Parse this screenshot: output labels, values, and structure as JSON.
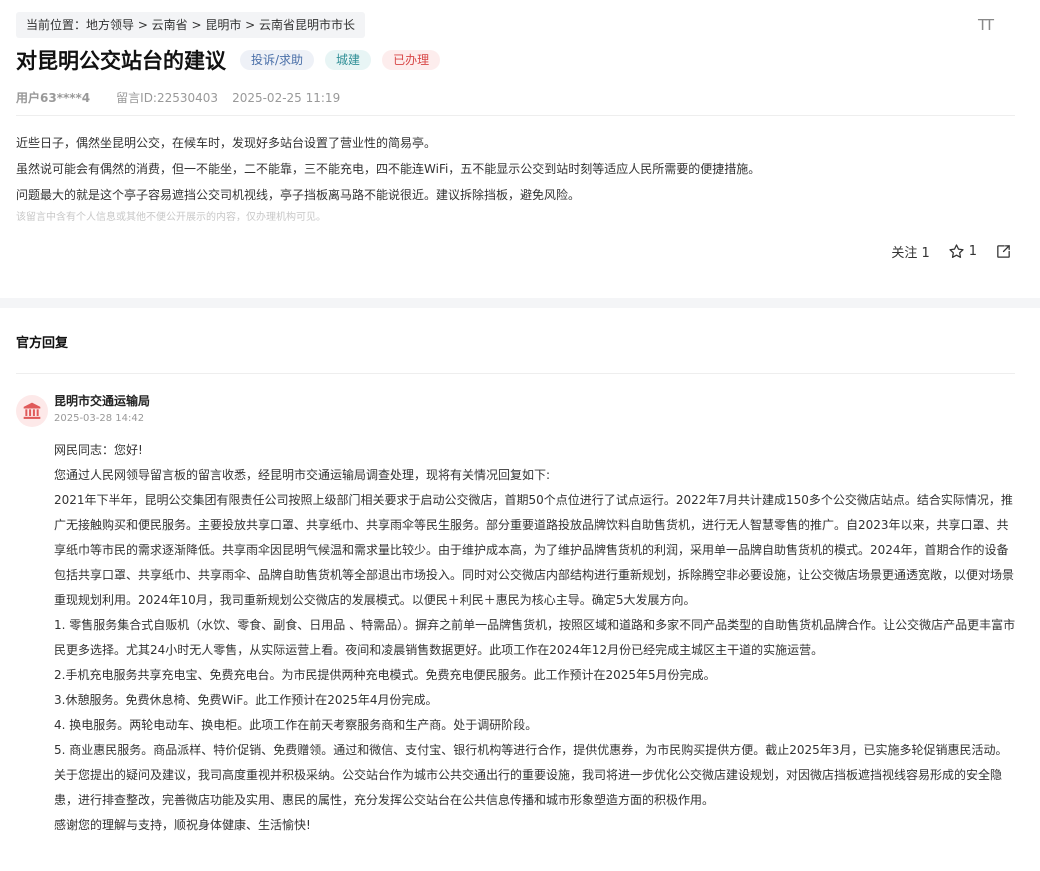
{
  "breadcrumb": "当前位置：地方领导 > 云南省 > 昆明市 > 云南省昆明市市长",
  "font_toggle": "TT",
  "title": "对昆明公交站台的建议",
  "tags": [
    "投诉/求助",
    "城建",
    "已办理"
  ],
  "meta": {
    "user": "用户63****4",
    "message_id": "留言ID:22530403",
    "datetime": "2025-02-25 11:19"
  },
  "content": [
    "近些日子，偶然坐昆明公交，在候车时，发现好多站台设置了营业性的简易亭。",
    "虽然说可能会有偶然的消费，但一不能坐，二不能靠，三不能充电，四不能连WiFi，五不能显示公交到站时刻等适应人民所需要的便捷措施。",
    "问题最大的就是这个亭子容易遮挡公交司机视线，亭子挡板离马路不能说很近。建议拆除挡板，避免风险。"
  ],
  "notice": "该留言中含有个人信息或其他不便公开展示的内容，仅办理机构可见。",
  "actions": {
    "follow": "关注 1",
    "star_count": "1"
  },
  "icons": {
    "star": "star-icon",
    "share": "share-icon",
    "org": "government-building-icon"
  },
  "reply": {
    "heading": "官方回复",
    "org_name": "昆明市交通运输局",
    "date": "2025-03-28 14:42",
    "body": "网民同志：您好!\n您通过人民网领导留言板的留言收悉，经昆明市交通运输局调查处理，现将有关情况回复如下:\n2021年下半年，昆明公交集团有限责任公司按照上级部门相关要求于启动公交微店，首期50个点位进行了试点运行。2022年7月共计建成150多个公交微店站点。结合实际情况，推广无接触购买和便民服务。主要投放共享口罩、共享纸巾、共享雨伞等民生服务。部分重要道路投放品牌饮料自助售货机，进行无人智慧零售的推广。自2023年以来，共享口罩、共享纸巾等市民的需求逐渐降低。共享雨伞因昆明气候温和需求量比较少。由于维护成本高，为了维护品牌售货机的利润，采用单一品牌自助售货机的模式。2024年，首期合作的设备包括共享口罩、共享纸巾、共享雨伞、品牌自助售货机等全部退出市场投入。同时对公交微店内部结构进行重新规划，拆除腾空非必要设施，让公交微店场景更通透宽敞，以便对场景重现规划利用。2024年10月，我司重新规划公交微店的发展模式。以便民＋利民＋惠民为核心主导。确定5大发展方向。\n1. 零售服务集合式自贩机（水饮、零食、副食、日用品 、特需品）。摒弃之前单一品牌售货机，按照区域和道路和多家不同产品类型的自助售货机品牌合作。让公交微店产品更丰富市民更多选择。尤其24小时无人零售，从实际运营上看。夜间和凌晨销售数据更好。此项工作在2024年12月份已经完成主城区主干道的实施运营。\n2.手机充电服务共享充电宝、免费充电台。为市民提供两种充电模式。免费充电便民服务。此工作预计在2025年5月份完成。\n3.休憩服务。免费休息椅、免费WiF。此工作预计在2025年4月份完成。\n4. 换电服务。两轮电动车、换电柜。此项工作在前天考察服务商和生产商。处于调研阶段。\n5. 商业惠民服务。商品派样、特价促销、免费赠领。通过和微信、支付宝、银行机构等进行合作，提供优惠券，为市民购买提供方便。截止2025年3月，已实施多轮促销惠民活动。\n关于您提出的疑问及建议，我司高度重视并积极采纳。公交站台作为城市公共交通出行的重要设施，我司将进一步优化公交微店建设规划，对因微店挡板遮挡视线容易形成的安全隐患，进行排查整改，完善微店功能及实用、惠民的属性，充分发挥公交站台在公共信息传播和城市形象塑造方面的积极作用。\n感谢您的理解与支持，顺祝身体健康、生活愉快!"
  }
}
